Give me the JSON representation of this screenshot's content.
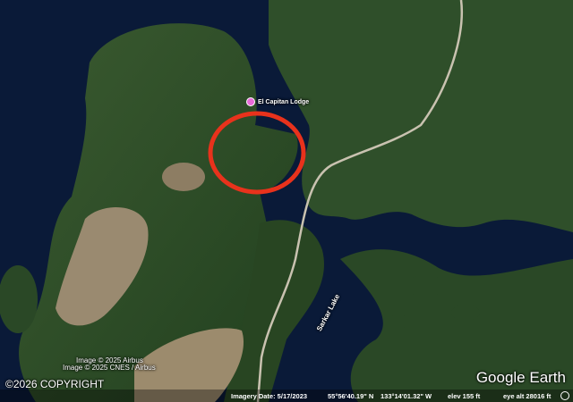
{
  "map": {
    "place_label": "El Capitan Lodge",
    "lake_label": "Sarkar Lake",
    "imagery_credits": [
      "Image © 2025 Airbus",
      "Image © 2025 CNES / Airbus"
    ],
    "copyright": "©2026 COPYRIGHT",
    "brand": "Google Earth"
  },
  "status_bar": {
    "imagery_date": "Imagery Date: 5/17/2023",
    "latitude": "55°56'40.19\" N",
    "longitude": "133°14'01.32\" W",
    "elevation": "elev  155 ft",
    "eye_alt": "eye alt  28016 ft"
  },
  "colors": {
    "water": "#0a1a38",
    "forest": "#2b4a27",
    "highlight_circle": "#e8321c",
    "lodge_pin": "#e86ad8"
  },
  "icons": [
    "lodge-pin-icon",
    "compass-icon"
  ]
}
